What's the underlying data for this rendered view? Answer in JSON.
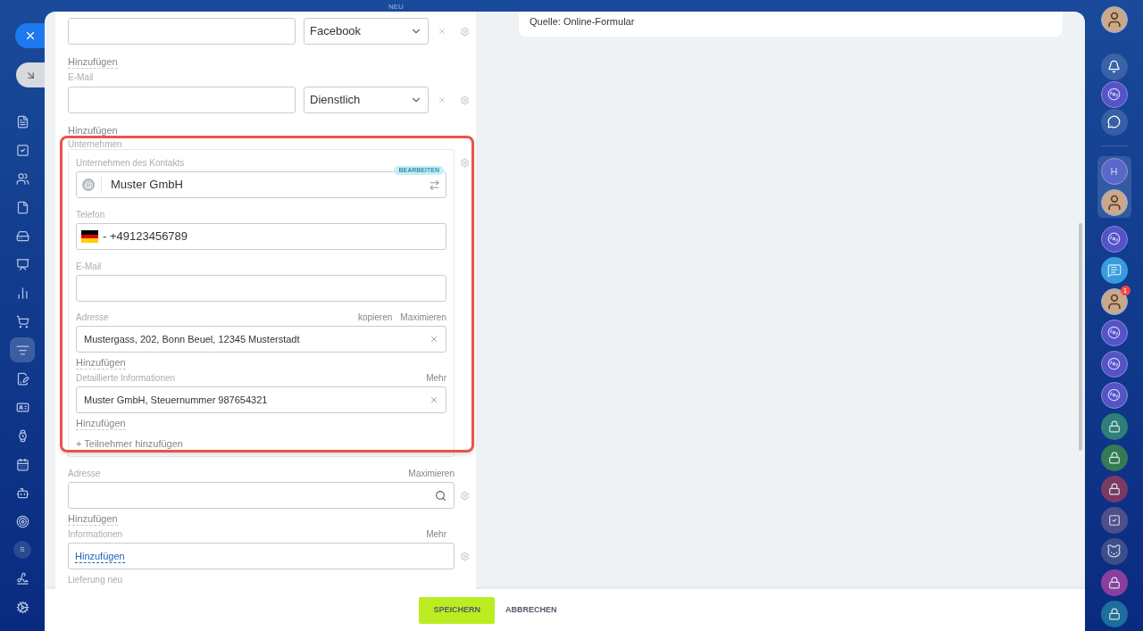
{
  "top_bar": {
    "badge": "NEU"
  },
  "left_nav": {
    "items": [
      {
        "kind": "icon",
        "selected": false
      },
      {
        "kind": "icon",
        "selected": false
      },
      {
        "kind": "icon",
        "selected": false
      },
      {
        "kind": "icon",
        "selected": false
      },
      {
        "kind": "icon",
        "selected": false
      },
      {
        "kind": "icon",
        "selected": false
      },
      {
        "kind": "icon",
        "selected": false
      },
      {
        "kind": "icon",
        "selected": false
      },
      {
        "kind": "icon",
        "selected": true
      },
      {
        "kind": "icon",
        "selected": false
      },
      {
        "kind": "icon",
        "selected": false
      },
      {
        "kind": "icon",
        "selected": false
      },
      {
        "kind": "icon",
        "selected": false
      },
      {
        "kind": "icon",
        "selected": false
      },
      {
        "kind": "icon",
        "selected": false
      },
      {
        "kind": "avatar",
        "label": "S",
        "selected": false
      },
      {
        "kind": "icon",
        "selected": false
      },
      {
        "kind": "icon",
        "selected": false
      }
    ]
  },
  "form": {
    "messenger": {
      "type": "Facebook",
      "add": "Hinzufügen"
    },
    "email": {
      "label": "E-Mail",
      "type": "Dienstlich",
      "add": "Hinzufügen"
    },
    "company": {
      "label": "Unternehmen",
      "company_field": {
        "label": "Unternehmen des Kontakts",
        "badge": "BEARBEITEN",
        "value": "Muster GmbH"
      },
      "phone": {
        "label": "Telefon",
        "value": "- +49123456789"
      },
      "email": {
        "label": "E-Mail"
      },
      "address": {
        "label": "Adresse",
        "actions": [
          "kopieren",
          "Maximieren"
        ],
        "value": "Mustergass, 202, Bonn Beuel, 12345 Musterstadt",
        "add": "Hinzufügen"
      },
      "details": {
        "label": "Detaillierte Informationen",
        "actions": [
          "Mehr"
        ],
        "value": "Muster GmbH, Steuernummer 987654321",
        "add": "Hinzufügen"
      },
      "add_participant": "+ Teilnehmer hinzufügen"
    },
    "address": {
      "label": "Adresse",
      "actions": [
        "Maximieren"
      ],
      "add": "Hinzufügen"
    },
    "info": {
      "label": "Informationen",
      "actions": [
        "Mehr"
      ],
      "link": "Hinzufügen"
    },
    "delivery": {
      "label": "Lieferung neu"
    }
  },
  "source_card": {
    "text": "Quelle: Online-Formular"
  },
  "footer": {
    "buttons": [
      {
        "label": "SPEICHERN",
        "kind": "primary"
      },
      {
        "label": "ABBRECHEN",
        "kind": "plain"
      }
    ]
  },
  "right_bar": {
    "top": [
      {
        "kind": "user"
      },
      {
        "kind": "bell"
      },
      {
        "kind": "channel"
      },
      {
        "kind": "chat"
      }
    ],
    "group": [
      {
        "kind": "letter",
        "label": "H"
      },
      {
        "kind": "user"
      }
    ],
    "items": [
      {
        "kind": "channel"
      },
      {
        "kind": "message"
      },
      {
        "kind": "user",
        "badge": "1"
      },
      {
        "kind": "channel"
      },
      {
        "kind": "channel"
      },
      {
        "kind": "channel"
      },
      {
        "kind": "lock",
        "color": "#2e7f78"
      },
      {
        "kind": "lock",
        "color": "#347a55"
      },
      {
        "kind": "lock",
        "color": "#7a3a62"
      },
      {
        "kind": "task",
        "color": "#4e4f8a"
      },
      {
        "kind": "mascot"
      },
      {
        "kind": "lock",
        "color": "#8a3f9e"
      },
      {
        "kind": "lock",
        "color": "#1c6f9a"
      }
    ]
  }
}
